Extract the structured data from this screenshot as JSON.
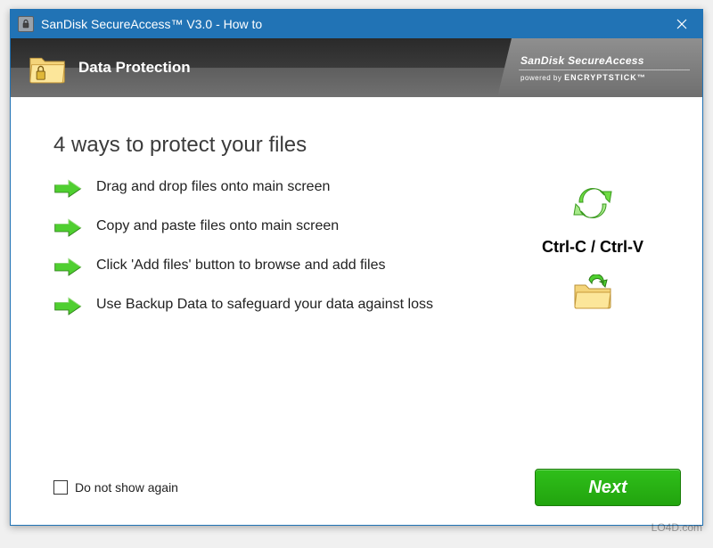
{
  "titlebar": {
    "title": "SanDisk SecureAccess™ V3.0 - How to"
  },
  "banner": {
    "title": "Data Protection",
    "brand_line1": "SanDisk SecureAccess",
    "brand_powered": "powered by",
    "brand_name": "ENCRYPTSTICK™"
  },
  "content": {
    "heading": "4 ways to protect your files",
    "items": [
      "Drag and drop files onto main screen",
      "Copy and paste files onto main screen",
      "Click 'Add files' button to browse and add files",
      "Use Backup Data to safeguard your data against loss"
    ],
    "shortcut": "Ctrl-C / Ctrl-V"
  },
  "footer": {
    "checkbox_label": "Do not show again",
    "next_label": "Next"
  },
  "watermark": "LO4D.com"
}
